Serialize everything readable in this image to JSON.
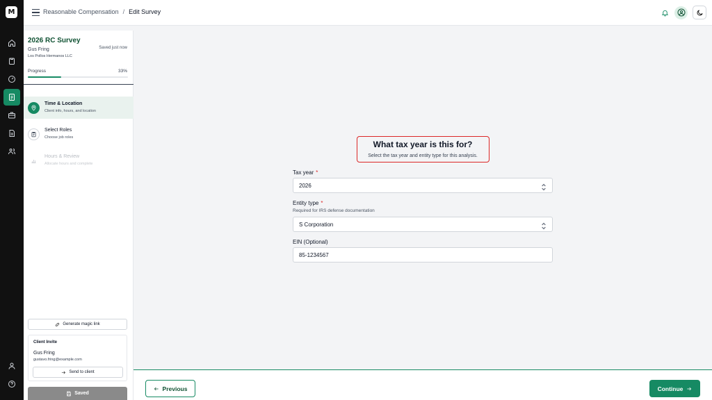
{
  "app": {
    "logo_text": "M"
  },
  "breadcrumb": {
    "parent": "Reasonable Compensation",
    "separator": "/",
    "current": "Edit Survey"
  },
  "nav": {
    "icons": [
      "home-icon",
      "clipboard-icon",
      "gauge-icon",
      "survey-icon",
      "briefcase-icon",
      "document-icon",
      "users-icon"
    ],
    "active": "survey-icon",
    "bottom_icons": [
      "user-icon",
      "help-icon"
    ]
  },
  "sidebar": {
    "survey_title": "2026 RC Survey",
    "saved_status": "Saved just now",
    "client_name": "Gus Fring",
    "client_company": "Los Pollos Hermanos LLC",
    "progress_label": "Progress",
    "progress_value": "33%",
    "progress_fraction": 0.33,
    "steps": [
      {
        "title": "Time & Location",
        "subtitle": "Client info, hours, and location",
        "state": "active"
      },
      {
        "title": "Select Roles",
        "subtitle": "Choose job roles",
        "state": "pending"
      },
      {
        "title": "Hours & Review",
        "subtitle": "Allocate hours and complete",
        "state": "disabled"
      }
    ],
    "magic_link_label": "Generate magic link",
    "invite": {
      "title": "Client Invite",
      "name": "Gus Fring",
      "email": "gustavo.fring@example.com",
      "send_label": "Send to client"
    },
    "saved_label": "Saved"
  },
  "form": {
    "question_title": "What tax year is this for?",
    "question_subtitle": "Select the tax year and entity type for this analysis.",
    "tax_year": {
      "label": "Tax year",
      "required_mark": "*",
      "value": "2026"
    },
    "entity_type": {
      "label": "Entity type",
      "required_mark": "*",
      "help": "Required for IRS defense documentation",
      "value": "S Corporation"
    },
    "ein": {
      "label": "EIN (Optional)",
      "value": "85-1234567"
    }
  },
  "footer": {
    "previous_label": "Previous",
    "continue_label": "Continue"
  },
  "colors": {
    "accent": "#168a63",
    "highlight_border": "#dc2626",
    "rail_bg": "#111111"
  }
}
